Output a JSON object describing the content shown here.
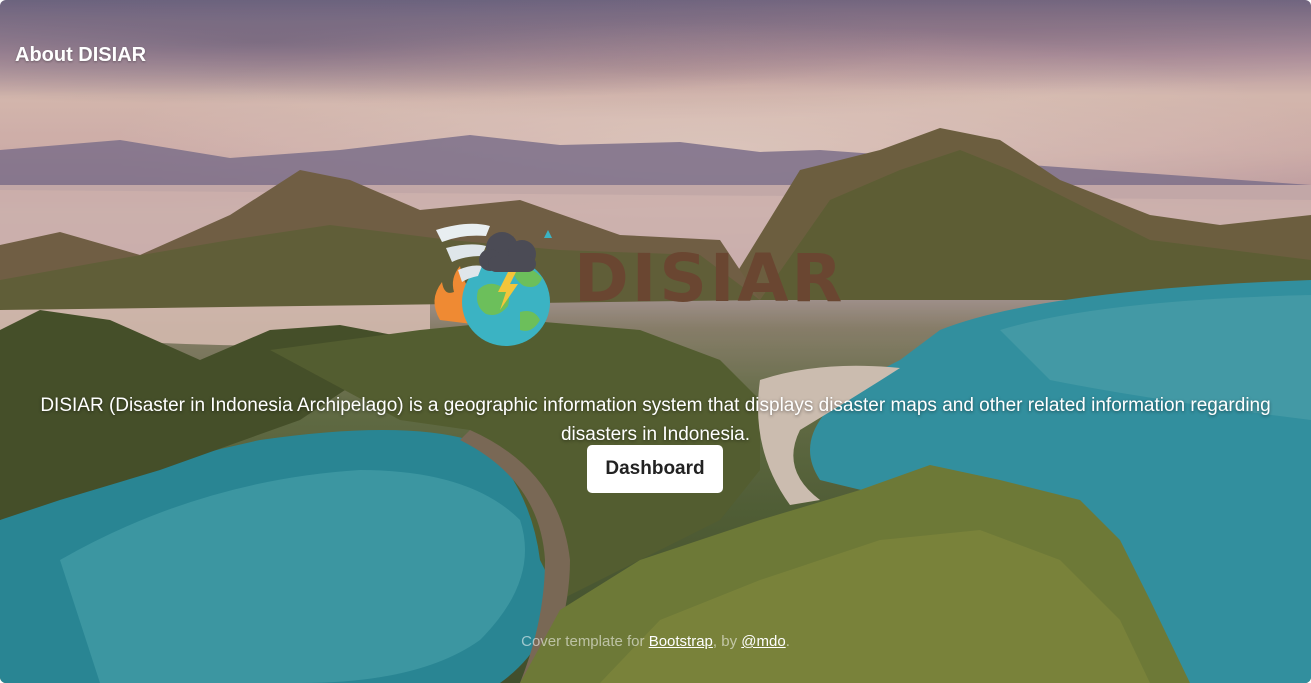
{
  "header": {
    "title": "About DISIAR"
  },
  "logo": {
    "brand_text": "DISIAR",
    "brand_color": "#6a4631"
  },
  "main": {
    "lead": "DISIAR (Disaster in Indonesia Archipelago) is a geographic information system that displays disaster maps and other related information regarding disasters in Indonesia.",
    "button_label": "Dashboard"
  },
  "footer": {
    "prefix": "Cover template for ",
    "link1": "Bootstrap",
    "middle": ", by ",
    "link2": "@mdo",
    "suffix": "."
  },
  "colors": {
    "button_bg": "#ffffff",
    "text": "#ffffff",
    "sea": "#3aa3b4"
  }
}
